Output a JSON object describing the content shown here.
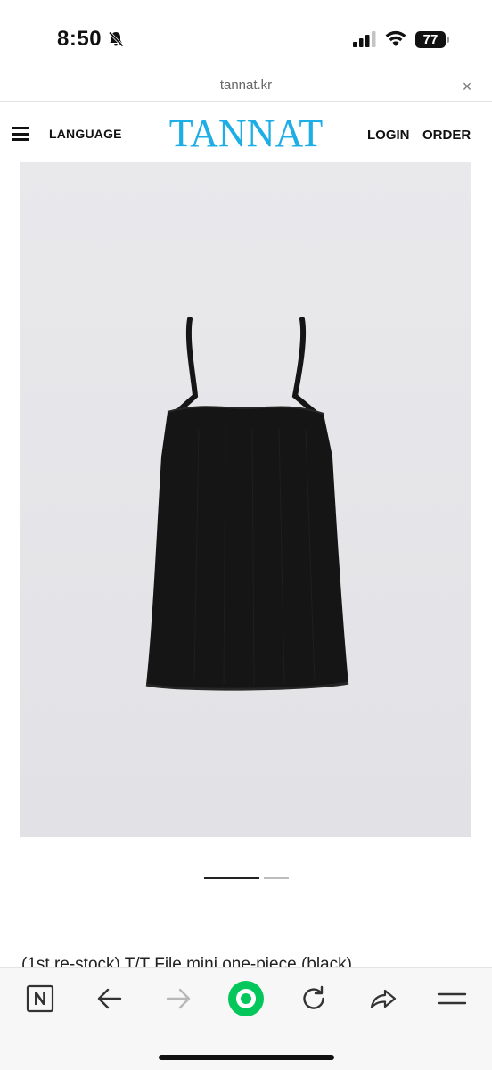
{
  "status_bar": {
    "time": "8:50",
    "battery_level": "77",
    "icons": [
      "bell-slash-icon",
      "cellular-signal-icon",
      "wifi-icon",
      "battery-icon"
    ]
  },
  "url_bar": {
    "domain": "tannat.kr",
    "close_label": "×"
  },
  "header": {
    "language_label": "LANGUAGE",
    "logo_text": "TANNAT",
    "login_label": "LOGIN",
    "order_label": "ORDER",
    "logo_color": "#1eaee6"
  },
  "product": {
    "image_background": "#e7e7ea",
    "image_count": 2,
    "active_image": 1,
    "title": "(1st re-stock) T/T File mini one-piece (black)"
  },
  "toolbar": {
    "icons": [
      "naver-n-icon",
      "back-arrow-icon",
      "forward-arrow-icon",
      "green-home-icon",
      "refresh-icon",
      "share-icon",
      "menu-lines-icon"
    ],
    "accent_color": "#03c75a"
  }
}
